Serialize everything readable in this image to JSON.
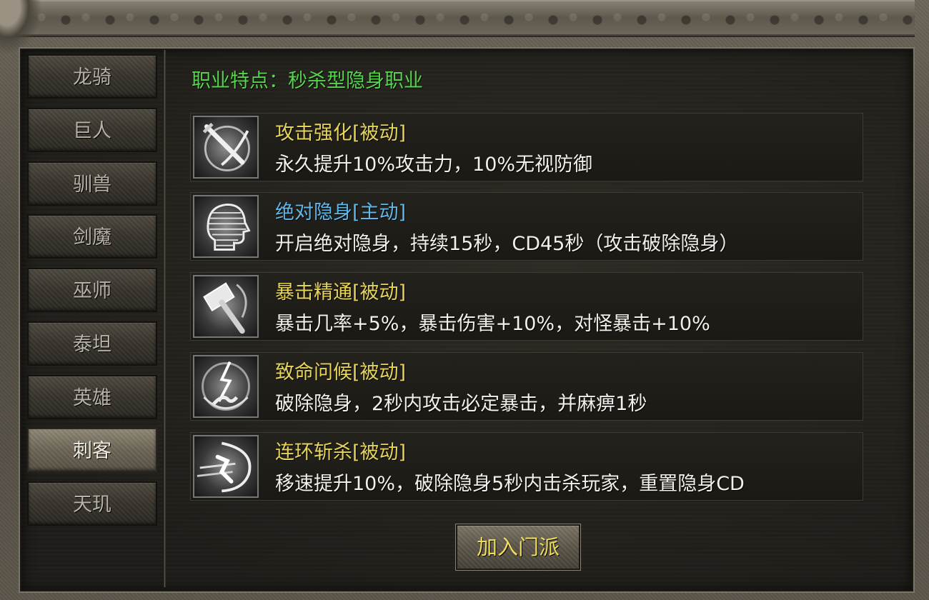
{
  "sidebar": {
    "items": [
      {
        "label": "龙骑"
      },
      {
        "label": "巨人"
      },
      {
        "label": "驯兽"
      },
      {
        "label": "剑魔"
      },
      {
        "label": "巫师"
      },
      {
        "label": "泰坦"
      },
      {
        "label": "英雄"
      },
      {
        "label": "刺客"
      },
      {
        "label": "天玑"
      }
    ],
    "selected": "刺客"
  },
  "main": {
    "trait_title": "职业特点：秒杀型隐身职业",
    "skills": [
      {
        "name": "攻击强化[被动]",
        "type": "passive",
        "icon": "sword-slash-icon",
        "description": "永久提升10%攻击力，10%无视防御"
      },
      {
        "name": "绝对隐身[主动]",
        "type": "active",
        "icon": "stealth-head-icon",
        "description": "开启绝对隐身，持续15秒，CD45秒（攻击破除隐身）"
      },
      {
        "name": "暴击精通[被动]",
        "type": "passive",
        "icon": "hammer-icon",
        "description": "暴击几率+5%，暴击伤害+10%，对怪暴击+10%"
      },
      {
        "name": "致命问候[被动]",
        "type": "passive",
        "icon": "lightning-strike-icon",
        "description": "破除隐身，2秒内攻击必定暴击，并麻痹1秒"
      },
      {
        "name": "连环斩杀[被动]",
        "type": "passive",
        "icon": "dash-slash-icon",
        "description": "移速提升10%，破除隐身5秒内击杀玩家，重置隐身CD"
      }
    ],
    "join_button": "加入门派"
  },
  "colors": {
    "trait_title": "#53d64a",
    "passive_skill_name": "#e6d45a",
    "active_skill_name": "#5fb8e8",
    "description": "#f2f0ea",
    "button_text": "#f0de5a"
  }
}
